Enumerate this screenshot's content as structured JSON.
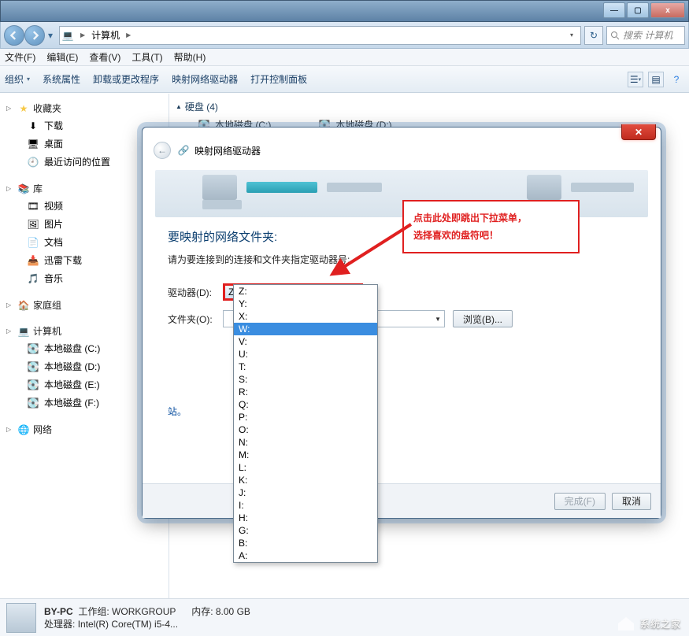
{
  "titlebar": {
    "min": "—",
    "max": "▢",
    "close": "x"
  },
  "nav": {
    "path_root": "计算机",
    "search_placeholder": "搜索 计算机"
  },
  "menus": [
    "文件(F)",
    "编辑(E)",
    "查看(V)",
    "工具(T)",
    "帮助(H)"
  ],
  "toolbar": {
    "org": "组织",
    "sysprops": "系统属性",
    "uninstall": "卸载或更改程序",
    "map": "映射网络驱动器",
    "ctrlpanel": "打开控制面板"
  },
  "sidebar": {
    "favorites": {
      "label": "收藏夹",
      "items": [
        "下载",
        "桌面",
        "最近访问的位置"
      ]
    },
    "libraries": {
      "label": "库",
      "items": [
        "视频",
        "图片",
        "文档",
        "迅雷下载",
        "音乐"
      ]
    },
    "homegroup": {
      "label": "家庭组"
    },
    "computer": {
      "label": "计算机",
      "items": [
        "本地磁盘 (C:)",
        "本地磁盘 (D:)",
        "本地磁盘 (E:)",
        "本地磁盘 (F:)"
      ]
    },
    "network": {
      "label": "网络"
    }
  },
  "content": {
    "section": "硬盘 (4)",
    "items": [
      "本地磁盘 (C:)",
      "本地磁盘 (D:)"
    ]
  },
  "dialog": {
    "title": "映射网络驱动器",
    "heading": "要映射的网络文件夹:",
    "subtext": "请为要连接到的连接和文件夹指定驱动器号:",
    "drive_label": "驱动器(D):",
    "drive_value": "Z:",
    "folder_label": "文件夹(O):",
    "browse": "浏览(B)...",
    "link_suffix": "站。",
    "finish": "完成(F)",
    "cancel": "取消"
  },
  "drive_options": [
    "Z:",
    "Y:",
    "X:",
    "W:",
    "V:",
    "U:",
    "T:",
    "S:",
    "R:",
    "Q:",
    "P:",
    "O:",
    "N:",
    "M:",
    "L:",
    "K:",
    "J:",
    "I:",
    "H:",
    "G:",
    "B:",
    "A:"
  ],
  "drive_highlight": "W:",
  "callout": {
    "line1": "点击此处即跳出下拉菜单，",
    "line2": "选择喜欢的盘符吧！"
  },
  "status": {
    "name": "BY-PC",
    "workgroup_label": "工作组:",
    "workgroup": "WORKGROUP",
    "mem_label": "内存:",
    "mem": "8.00 GB",
    "cpu_label": "处理器:",
    "cpu": "Intel(R) Core(TM) i5-4..."
  },
  "watermark": {
    "brand": "系统之家"
  }
}
